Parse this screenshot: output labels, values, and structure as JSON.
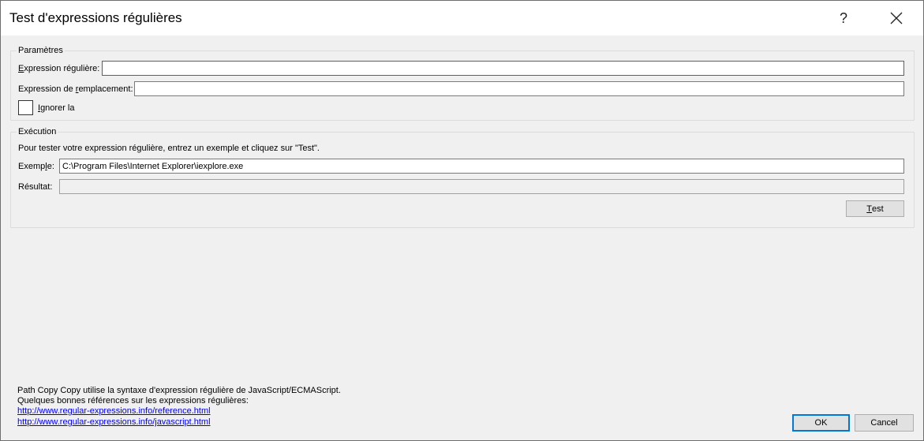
{
  "window": {
    "title": "Test d'expressions régulières",
    "help_glyph": "?"
  },
  "parameters": {
    "group_label": "Paramètres",
    "regex_label_accel": "E",
    "regex_label_rest": "xpression régulière:",
    "regex_value": "",
    "replacement_label_pre": "Expression de ",
    "replacement_label_accel": "r",
    "replacement_label_rest": "emplacement:",
    "replacement_value": "",
    "ignore_case_accel": "I",
    "ignore_case_rest": "gnorer la",
    "ignore_case_checked": false
  },
  "execution": {
    "group_label": "Exécution",
    "instructions": "Pour tester votre expression régulière, entrez un exemple et cliquez sur \"Test\".",
    "example_label_pre": "Exemp",
    "example_label_accel": "l",
    "example_label_rest": "e:",
    "example_value": "C:\\Program Files\\Internet Explorer\\iexplore.exe",
    "result_label": "Résultat:",
    "result_value": "",
    "test_button_accel": "T",
    "test_button_rest": "est"
  },
  "footer": {
    "syntax_note": "Path Copy Copy utilise la syntaxe d'expression régulière de JavaScript/ECMAScript.",
    "references_note": "Quelques bonnes références sur les expressions régulières:",
    "links": [
      "http://www.regular-expressions.info/reference.html",
      "http://www.regular-expressions.info/javascript.html"
    ],
    "ok_label": "OK",
    "cancel_label": "Cancel"
  }
}
